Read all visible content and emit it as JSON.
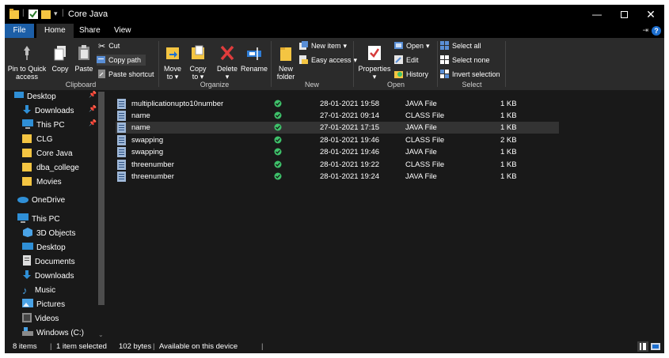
{
  "window": {
    "title": "Core Java",
    "controls": [
      "minimize",
      "maximize",
      "close"
    ]
  },
  "tabs": [
    {
      "label": "File"
    },
    {
      "label": "Home"
    },
    {
      "label": "Share"
    },
    {
      "label": "View"
    }
  ],
  "ribbon": {
    "clipboard": {
      "pin_label_1": "Pin to Quick",
      "pin_label_2": "access",
      "copy": "Copy",
      "paste": "Paste",
      "cut": "Cut",
      "copy_path": "Copy path",
      "paste_shortcut": "Paste shortcut",
      "group": "Clipboard"
    },
    "organize": {
      "move_1": "Move",
      "move_2": "to",
      "copy_1": "Copy",
      "copy_2": "to",
      "delete": "Delete",
      "rename": "Rename",
      "group": "Organize"
    },
    "new": {
      "new_folder_1": "New",
      "new_folder_2": "folder",
      "new_item": "New item",
      "easy_access": "Easy access",
      "group": "New"
    },
    "open": {
      "properties": "Properties",
      "open": "Open",
      "edit": "Edit",
      "history": "History",
      "group": "Open"
    },
    "select": {
      "select_all": "Select all",
      "select_none": "Select none",
      "invert": "Invert selection",
      "group": "Select"
    }
  },
  "nav": {
    "items": [
      {
        "label": "Desktop",
        "icon": "desktop-icon",
        "pinned": true
      },
      {
        "label": "Downloads",
        "icon": "download-icon",
        "pinned": true
      },
      {
        "label": "This PC",
        "icon": "pc-icon",
        "pinned": true
      },
      {
        "label": "CLG",
        "icon": "folder-icon"
      },
      {
        "label": "Core Java",
        "icon": "folder-icon"
      },
      {
        "label": "dba_college",
        "icon": "folder-icon"
      },
      {
        "label": "Movies",
        "icon": "folder-icon"
      },
      {
        "label": "OneDrive",
        "icon": "cloud-icon"
      },
      {
        "label": "This PC",
        "icon": "pc-icon"
      },
      {
        "label": "3D Objects",
        "icon": "cube-icon"
      },
      {
        "label": "Desktop",
        "icon": "desktop-icon"
      },
      {
        "label": "Documents",
        "icon": "document-icon"
      },
      {
        "label": "Downloads",
        "icon": "download-icon"
      },
      {
        "label": "Music",
        "icon": "music-icon"
      },
      {
        "label": "Pictures",
        "icon": "pictures-icon"
      },
      {
        "label": "Videos",
        "icon": "video-icon"
      },
      {
        "label": "Windows (C:)",
        "icon": "drive-icon"
      }
    ]
  },
  "files": [
    {
      "name": "multiplicationupto10number",
      "date": "28-01-2021 19:58",
      "type": "JAVA File",
      "size": "1 KB"
    },
    {
      "name": "name",
      "date": "27-01-2021 09:14",
      "type": "CLASS File",
      "size": "1 KB"
    },
    {
      "name": "name",
      "date": "27-01-2021 17:15",
      "type": "JAVA File",
      "size": "1 KB",
      "selected": true
    },
    {
      "name": "swapping",
      "date": "28-01-2021 19:46",
      "type": "CLASS File",
      "size": "2 KB"
    },
    {
      "name": "swapping",
      "date": "28-01-2021 19:46",
      "type": "JAVA File",
      "size": "1 KB"
    },
    {
      "name": "threenumber",
      "date": "28-01-2021 19:22",
      "type": "CLASS File",
      "size": "1 KB"
    },
    {
      "name": "threenumber",
      "date": "28-01-2021 19:24",
      "type": "JAVA File",
      "size": "1 KB"
    }
  ],
  "status": {
    "items": "8 items",
    "selected": "1 item selected",
    "size": "102 bytes",
    "availability": "Available on this device"
  },
  "colors": {
    "accent": "#1c5fa8",
    "synced": "#3ec26a",
    "folder": "#f4c542"
  }
}
